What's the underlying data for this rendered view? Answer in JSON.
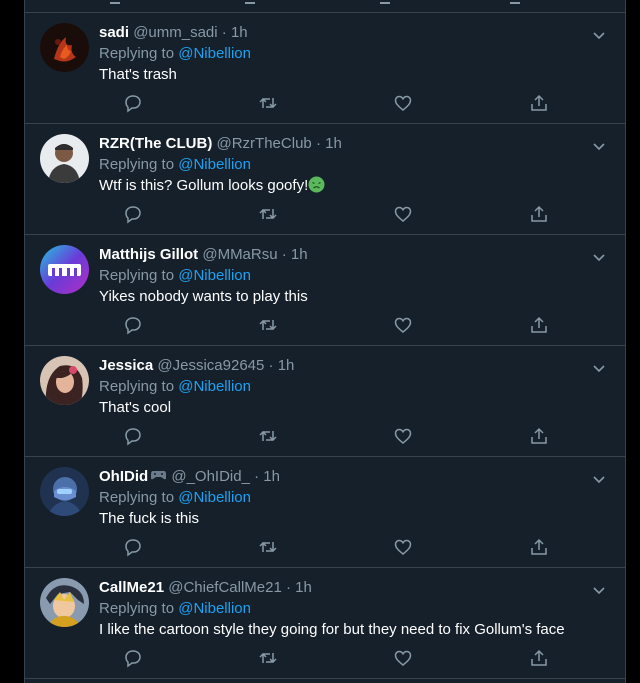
{
  "tweets": [
    {
      "name": "sadi",
      "handle": "@umm_sadi",
      "time": "1h",
      "replying_label": "Replying to ",
      "mention": "@Nibellion",
      "text": "That's trash"
    },
    {
      "name": "RZR(The CLUB)",
      "handle": "@RzrTheClub",
      "time": "1h",
      "replying_label": "Replying to ",
      "mention": "@Nibellion",
      "text": "Wtf is this? Gollum looks goofy!",
      "emoji": "nauseated-face-icon"
    },
    {
      "name": "Matthijs Gillot",
      "handle": "@MMaRsu",
      "time": "1h",
      "replying_label": "Replying to ",
      "mention": "@Nibellion",
      "text": "Yikes nobody wants to play this"
    },
    {
      "name": "Jessica",
      "handle": "@Jessica92645",
      "time": "1h",
      "replying_label": "Replying to ",
      "mention": "@Nibellion",
      "text": "That's cool"
    },
    {
      "name": "OhIDid",
      "handle": "@_OhIDid_",
      "time": "1h",
      "replying_label": "Replying to ",
      "mention": "@Nibellion",
      "text": "The fuck is this",
      "name_icon": "game-controller-icon"
    },
    {
      "name": "CallMe21",
      "handle": "@ChiefCallMe21",
      "time": "1h",
      "replying_label": "Replying to ",
      "mention": "@Nibellion",
      "text": "I like the cartoon style they going for but they need to fix Gollum's face"
    }
  ],
  "separator": "·",
  "icons": {
    "reply": "reply-icon",
    "retweet": "retweet-icon",
    "like": "heart-icon",
    "share": "share-icon",
    "caret": "chevron-down-icon"
  },
  "colors": {
    "background": "#15202b",
    "border": "#38444d",
    "secondary_text": "#8899a6",
    "mention": "#1da1f2",
    "primary_text": "#ffffff"
  }
}
